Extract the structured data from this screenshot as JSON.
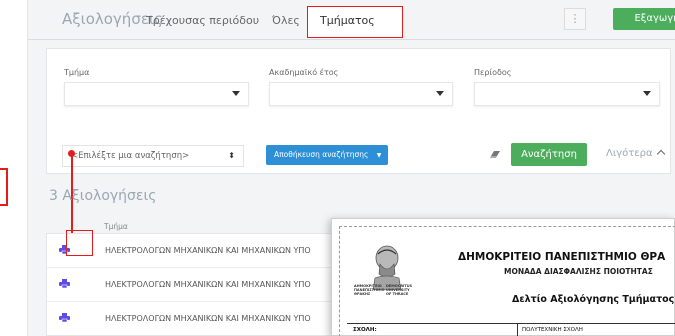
{
  "header": {
    "title": "Αξιολογήσεις",
    "tabs": [
      {
        "label": "Τρέχουσας περιόδου"
      },
      {
        "label": "Όλες"
      },
      {
        "label": "Τμήματος"
      }
    ],
    "more_label": "⋮",
    "export_label": "Εξαγωγή"
  },
  "filters": {
    "department_label": "Τμήμα",
    "year_label": "Ακαδημαϊκό έτος",
    "period_label": "Περίοδος",
    "saved_search_placeholder": "<Επιλέξτε μια αναζήτηση>",
    "save_search_label": "Αποθήκευση αναζήτησης",
    "search_label": "Αναζήτηση",
    "less_label": "Λιγότερα"
  },
  "results": {
    "title": "3 Αξιολογήσεις",
    "column_department": "Τμήμα",
    "rows": [
      {
        "department": "ΗΛΕΚΤΡΟΛΟΓΩΝ ΜΗΧΑΝΙΚΩΝ ΚΑΙ ΜΗΧΑΝΙΚΩΝ ΥΠΟ"
      },
      {
        "department": "ΗΛΕΚΤΡΟΛΟΓΩΝ ΜΗΧΑΝΙΚΩΝ ΚΑΙ ΜΗΧΑΝΙΚΩΝ ΥΠΟ"
      },
      {
        "department": "ΗΛΕΚΤΡΟΛΟΓΩΝ ΜΗΧΑΝΙΚΩΝ ΚΑΙ ΜΗΧΑΝΙΚΩΝ ΥΠΟ"
      }
    ]
  },
  "document": {
    "logo_left": "ΔΗΜΟΚΡΙΤΕΙΟ ΠΑΝΕΠΙΣΤΗΜΙΟ ΘΡΑΚΗΣ",
    "logo_right": "DEMOCRITUS UNIVERSITY OF THRACE",
    "university": "ΔΗΜΟΚΡΙΤΕΙΟ ΠΑΝΕΠΙΣΤΗΜΙΟ ΘΡΑ",
    "unit": "ΜΟΝΑΔΑ ΔΙΑΣΦΑΛΙΣΗΣ ΠΟΙΟΤΗΤΑΣ",
    "report_title": "Δελτίο Αξιολόγησης Τμήματος",
    "school_label": "ΣΧΟΛΗ:",
    "school_value": "ΠΟΛΥΤΕΧΝΙΚΗ ΣΧΟΛΗ"
  },
  "colors": {
    "accent_green": "#4cae5c",
    "accent_blue": "#2d8fd5",
    "print_icon": "#5b4de6",
    "highlight_red": "#e41c1c"
  },
  "icons": {
    "print": "print-icon",
    "eraser": "eraser-icon",
    "chevron_up": "chevron-up-icon",
    "caret": "caret-down-icon"
  }
}
